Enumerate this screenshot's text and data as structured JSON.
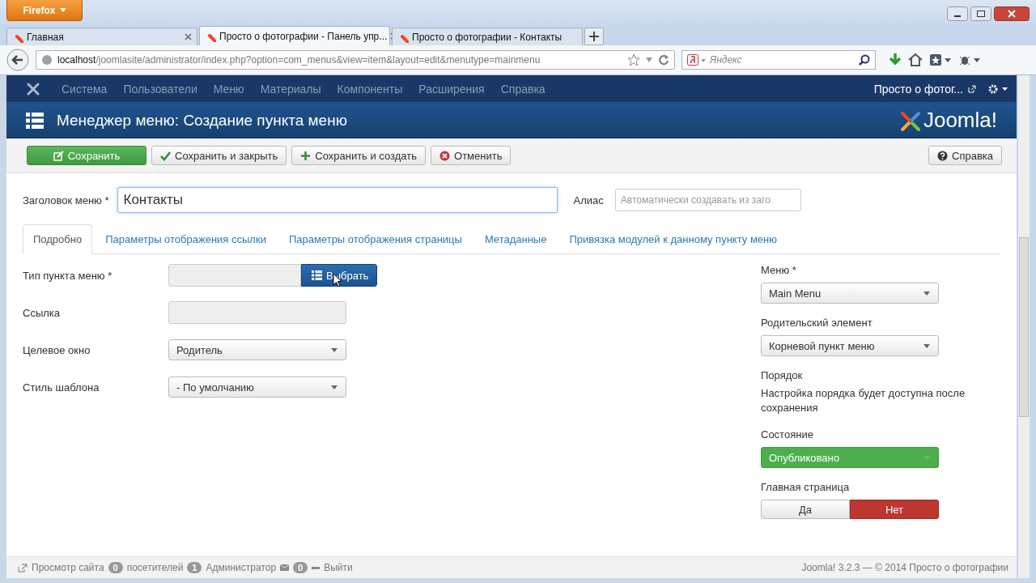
{
  "browser": {
    "app_button": "Firefox",
    "tabs": [
      {
        "title": "Главная",
        "selected": false
      },
      {
        "title": "Просто о фотографии - Панель упр...",
        "selected": true
      },
      {
        "title": "Просто о фотографии - Контакты",
        "selected": false
      }
    ],
    "url": {
      "host": "localhost",
      "path": "/joomlasite/administrator/index.php?option=com_menus&view=item&layout=edit&menutype=mainmenu"
    },
    "search": {
      "placeholder": "Яндекс"
    }
  },
  "admin_nav": {
    "items": [
      "Система",
      "Пользователи",
      "Меню",
      "Материалы",
      "Компоненты",
      "Расширения",
      "Справка"
    ],
    "site_link": "Просто о фотог..."
  },
  "header": {
    "title": "Менеджер меню: Создание пункта меню",
    "logo": "Joomla!"
  },
  "toolbar": {
    "buttons": [
      {
        "label": "Сохранить",
        "kind": "save"
      },
      {
        "label": "Сохранить и закрыть",
        "kind": "check"
      },
      {
        "label": "Сохранить и создать",
        "kind": "plus"
      },
      {
        "label": "Отменить",
        "kind": "cancel"
      }
    ],
    "help": "Справка"
  },
  "title_row": {
    "label": "Заголовок меню *",
    "value": "Контакты",
    "alias_label": "Алиас",
    "alias_placeholder": "Автоматически создавать из заго"
  },
  "tabs": [
    {
      "label": "Подробно",
      "selected": true
    },
    {
      "label": "Параметры отображения ссылки",
      "selected": false
    },
    {
      "label": "Параметры отображения страницы",
      "selected": false
    },
    {
      "label": "Метаданные",
      "selected": false
    },
    {
      "label": "Привязка модулей к данному пункту меню",
      "selected": false
    }
  ],
  "fields": [
    {
      "label": "Тип пункта меню *",
      "kind": "picker",
      "button": "Выбрать"
    },
    {
      "label": "Ссылка",
      "kind": "readonly"
    },
    {
      "label": "Целевое окно",
      "kind": "select",
      "value": "Родитель"
    },
    {
      "label": "Стиль шаблона",
      "kind": "select",
      "value": "- По умолчанию"
    }
  ],
  "side": [
    {
      "label": "Меню *",
      "kind": "select",
      "value": "Main Menu"
    },
    {
      "label": "Родительский элемент",
      "kind": "select",
      "value": "Корневой пункт меню"
    },
    {
      "label": "Порядок",
      "kind": "note",
      "text": "Настройка порядка будет доступна после сохранения"
    },
    {
      "label": "Состояние",
      "kind": "select",
      "value": "Опубликовано",
      "color": "#4cae4c"
    },
    {
      "label": "Главная страница",
      "kind": "toggle",
      "options": [
        {
          "label": "Да",
          "selected": false
        },
        {
          "label": "Нет",
          "selected": true
        }
      ]
    }
  ],
  "status_bar": {
    "view_site": "Просмотр сайта",
    "visitors_count": "0",
    "visitors": "посетителей",
    "admins_count": "1",
    "admins": "Администратор",
    "messages_count": "0",
    "logout": "Выйти",
    "version": "Joomla! 3.2.3 — © 2014 Просто о фотографии"
  }
}
